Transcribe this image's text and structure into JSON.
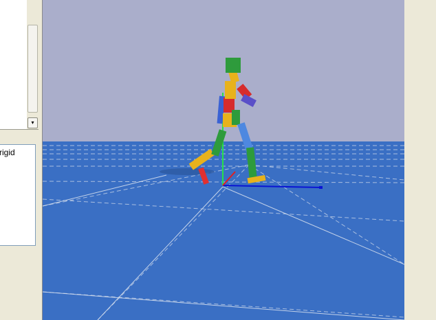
{
  "left_panel": {
    "bottom_list_item": "rigid"
  },
  "scrollbar": {
    "down_arrow": "▾"
  },
  "viewport": {
    "sky_color": "#aaaecb",
    "floor_color": "#3a6fc4",
    "grid_color": "#c8d4e6"
  }
}
